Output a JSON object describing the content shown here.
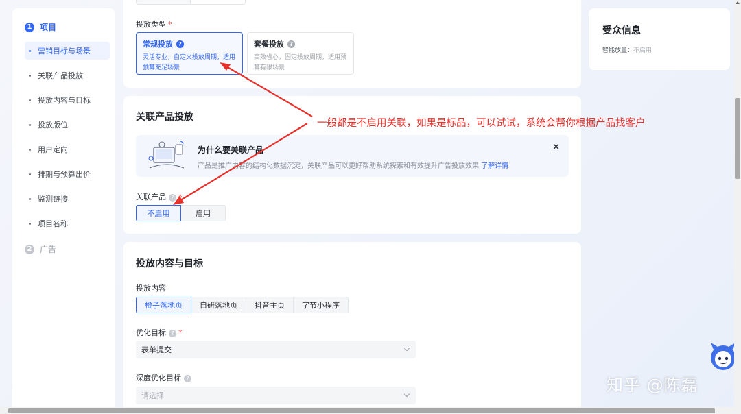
{
  "sidebar": {
    "step1": {
      "num": "1",
      "label": "项目"
    },
    "items": [
      {
        "label": "营销目标与场景"
      },
      {
        "label": "关联产品投放"
      },
      {
        "label": "投放内容与目标"
      },
      {
        "label": "投放版位"
      },
      {
        "label": "用户定向"
      },
      {
        "label": "排期与预算出价"
      },
      {
        "label": "监测链接"
      },
      {
        "label": "项目名称"
      }
    ],
    "step2": {
      "num": "2",
      "label": "广告"
    }
  },
  "delivery_type": {
    "label": "投放类型",
    "required": "*",
    "options": [
      {
        "title": "常规投放",
        "desc": "灵活专业，自定义投放周期，适用预算充足场景"
      },
      {
        "title": "套餐投放",
        "desc": "高效省心，固定投放周期，适用预算有限场景"
      }
    ]
  },
  "related_product": {
    "section_title": "关联产品投放",
    "info": {
      "title": "为什么要关联产品",
      "desc": "产品是推广内容的结构化数据沉淀，关联产品可以更好帮助系统探索和有效提升广告投放效果",
      "link": "了解详情",
      "close": "×"
    },
    "field_label": "关联产品",
    "required": "*",
    "options": [
      "不启用",
      "启用"
    ]
  },
  "content_target": {
    "section_title": "投放内容与目标",
    "content_label": "投放内容",
    "content_options": [
      "橙子落地页",
      "自研落地页",
      "抖音主页",
      "字节小程序"
    ],
    "opt_goal_label": "优化目标",
    "required": "*",
    "opt_goal_value": "表单提交",
    "deep_goal_label": "深度优化目标",
    "deep_goal_placeholder": "请选择"
  },
  "audience": {
    "title": "受众信息",
    "smart_label": "智能放量：",
    "smart_value": "不启用"
  },
  "annotation": {
    "text": "一般都是不启用关联，如果是标品，可以试试，系统会帮你根据产品找客户",
    "color": "#e8302b"
  },
  "watermark": "知乎 @陈磊",
  "colors": {
    "accent": "#3367f3",
    "required": "#e23c3c"
  }
}
